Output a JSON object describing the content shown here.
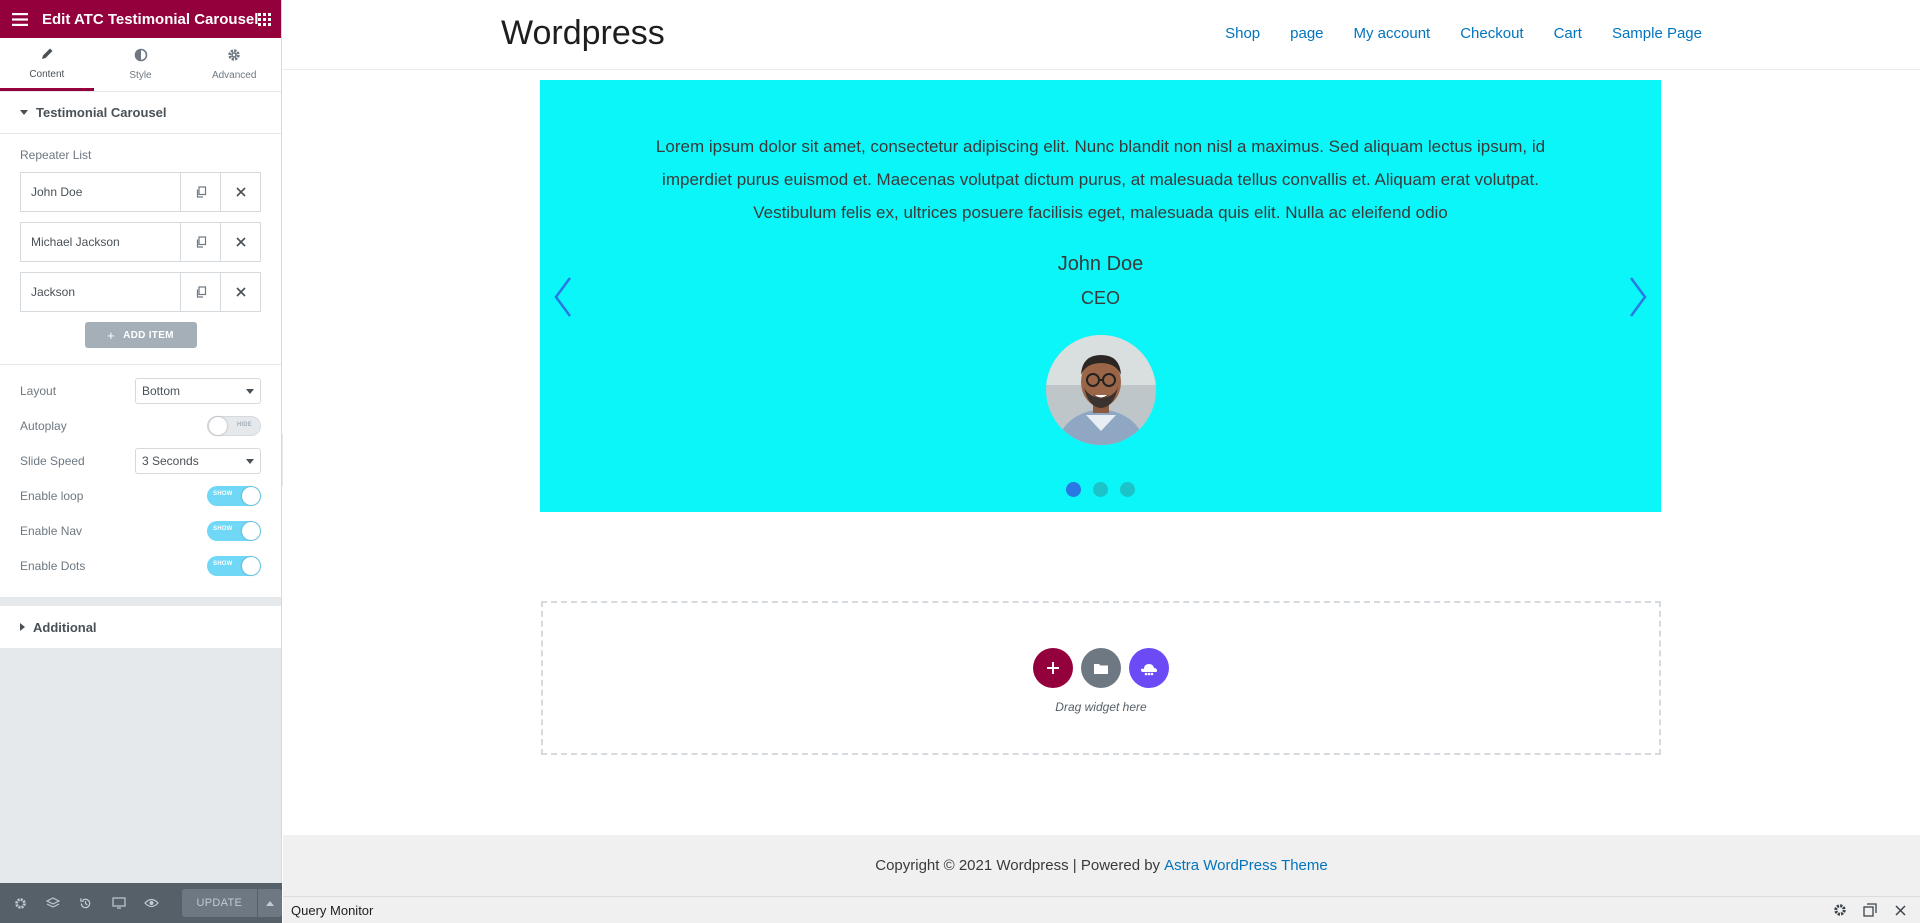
{
  "panel": {
    "title": "Edit ATC Testimonial Carousel",
    "tabs": [
      {
        "label": "Content",
        "icon": "pencil-icon"
      },
      {
        "label": "Style",
        "icon": "half-circle-icon"
      },
      {
        "label": "Advanced",
        "icon": "gear-icon"
      }
    ],
    "section_title": "Testimonial Carousel",
    "repeater_label": "Repeater List",
    "repeater_items": [
      "John Doe",
      "Michael Jackson",
      "Jackson"
    ],
    "add_item_label": "ADD ITEM",
    "controls": {
      "layout_label": "Layout",
      "layout_value": "Bottom",
      "autoplay_label": "Autoplay",
      "autoplay_state": "HIDE",
      "slide_speed_label": "Slide Speed",
      "slide_speed_value": "3 Seconds",
      "loop_label": "Enable loop",
      "loop_state": "SHOW",
      "nav_label": "Enable Nav",
      "nav_state": "SHOW",
      "dots_label": "Enable Dots",
      "dots_state": "SHOW"
    },
    "additional_title": "Additional",
    "footer": {
      "update_label": "UPDATE"
    },
    "accent_color": "#93003c"
  },
  "site": {
    "title": "Wordpress",
    "nav": [
      "Shop",
      "page",
      "My account",
      "Checkout",
      "Cart",
      "Sample Page"
    ],
    "link_color": "#0274be"
  },
  "carousel": {
    "background": "#0af6f9",
    "quote": "Lorem ipsum dolor sit amet, consectetur adipiscing elit. Nunc blandit non nisl a maximus. Sed aliquam lectus ipsum, id imperdiet purus euismod et. Maecenas volutpat dictum purus, at malesuada tellus convallis et. Aliquam erat volutpat. Vestibulum felis ex, ultrices posuere facilisis eget, malesuada quis elit. Nulla ac eleifend odio",
    "name": "John Doe",
    "role": "CEO",
    "dot_count": 3,
    "active_dot": 0
  },
  "dropzone": {
    "text": "Drag widget here"
  },
  "footer": {
    "text": "Copyright © 2021 Wordpress | Powered by",
    "link": "Astra WordPress Theme"
  },
  "query_monitor": {
    "title": "Query Monitor"
  }
}
